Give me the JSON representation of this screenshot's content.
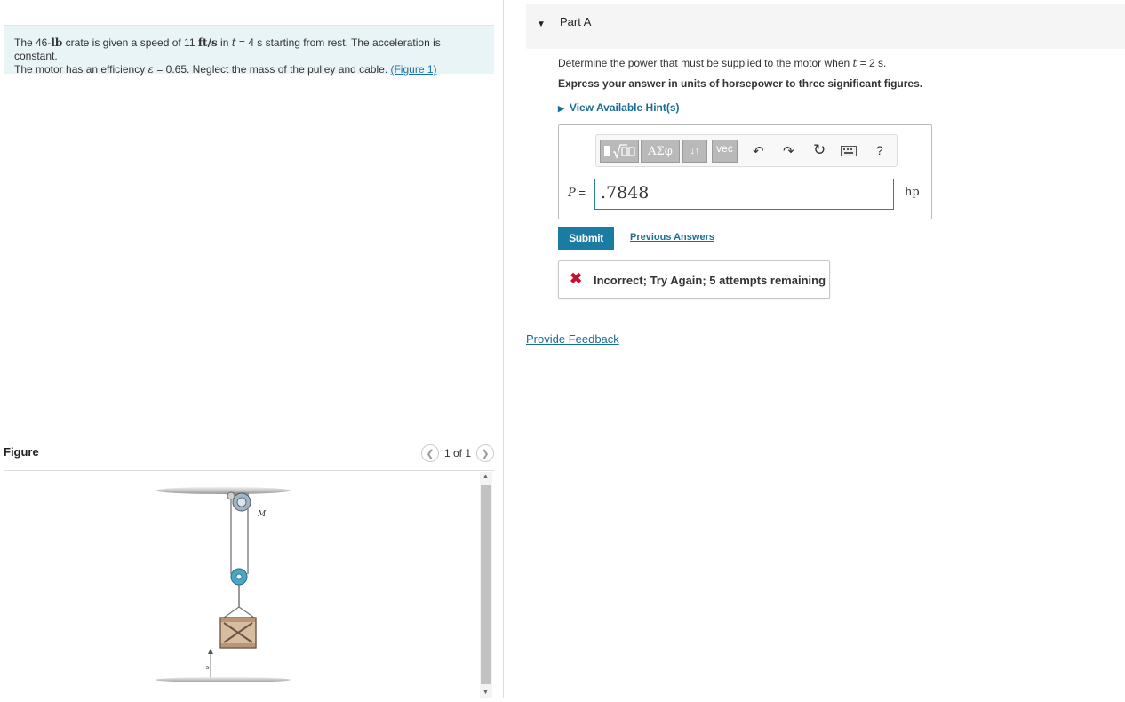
{
  "problem": {
    "text1": "The 46-",
    "weight_unit": "lb",
    "text2": " crate is given a speed of 11 ",
    "speed_unit": "ft/s",
    "text3": " in ",
    "t_var": "t",
    "text4": " = 4 s starting from rest. The acceleration is constant.",
    "text5": "The motor has an efficiency ",
    "eps": "ε",
    "text6": " = 0.65. Neglect the mass of the pulley and cable. ",
    "figure_link": "(Figure 1)"
  },
  "figure": {
    "title": "Figure",
    "pager": "1 of 1",
    "motor_label": "M",
    "height_label": "s"
  },
  "part": {
    "title": "Part A",
    "q1": "Determine the power that must be supplied to the motor when ",
    "q_var": "t",
    "q2": " = 2 s.",
    "instruction": "Express your answer in units of horsepower to three significant figures.",
    "hints": "View Available Hint(s)"
  },
  "toolbar": {
    "greek": "ΑΣφ",
    "arrows": "↓↑",
    "vec": "vec",
    "help": "?"
  },
  "answer": {
    "var": "P",
    "eq": " =",
    "value": ".7848",
    "unit": "hp"
  },
  "buttons": {
    "submit": "Submit",
    "previous": "Previous Answers"
  },
  "feedback": {
    "icon": "✖",
    "message": "Incorrect; Try Again; 5 attempts remaining"
  },
  "provide_feedback": "Provide Feedback",
  "colors": {
    "accent": "#1a7ba3",
    "error": "#c8102e",
    "problem_bg": "#e8f4f6"
  }
}
